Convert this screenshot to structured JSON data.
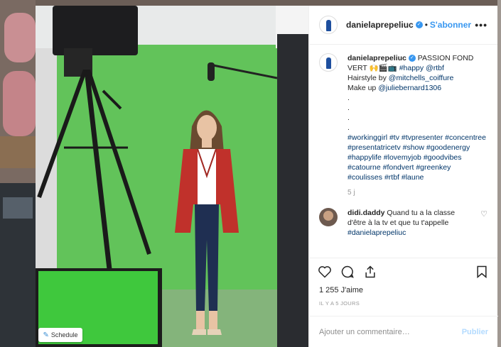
{
  "header": {
    "username": "danielaprepeliuc",
    "separator": "•",
    "follow_label": "S'abonner",
    "more_label": "•••"
  },
  "caption": {
    "username": "danielaprepeliuc",
    "line1": "PASSION FOND VERT",
    "emoji_text": "🙌🎬📺",
    "tags_inline": [
      "#happy",
      "@rtbf"
    ],
    "hair_label": "Hairstyle by",
    "hair_link": "@mitchells_coiffure",
    "makeup_label": "Make up",
    "makeup_link": "@juliebernard1306",
    "dots": [
      ".",
      ".",
      ".",
      "."
    ],
    "hashtags": "#workinggirl #tv #tvpresenter #concentree #presentatricetv #show #goodenergy #happylife #lovemyjob #goodvibes #catourne #fondvert #greenkey #coulisses #rtbf #laune",
    "time": "5 j"
  },
  "comments": [
    {
      "username": "didi.daddy",
      "text": "Quand tu a la classe d'être à la tv et que tu t'appelle",
      "mention": "#danielaprepeliuc",
      "heart": "♡"
    }
  ],
  "actions": {
    "like_icon": "heart-icon",
    "comment_icon": "comment-icon",
    "share_icon": "share-icon",
    "save_icon": "bookmark-icon"
  },
  "likes": "1 255 J'aime",
  "post_date": "IL Y A 5 JOURS",
  "add_comment": {
    "placeholder": "Ajouter un commentaire…",
    "publish_label": "Publier"
  },
  "schedule": {
    "label": "Schedule"
  },
  "colors": {
    "accent": "#3897f0",
    "link": "#003569",
    "green_screen": "#62c35a",
    "jacket": "#c0312b"
  }
}
